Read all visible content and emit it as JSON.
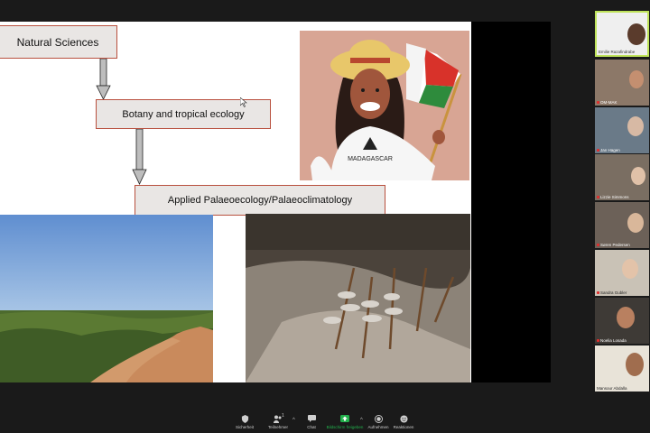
{
  "slide": {
    "flow": [
      "Natural Sciences",
      "Botany and tropical ecology",
      "Applied Palaeoecology/Palaeoclimatology"
    ],
    "illustration_text": "MADAGASCAR"
  },
  "participants": [
    {
      "name": "Emilie Razafindrabe",
      "active": true
    },
    {
      "name": "OM-MAK",
      "active": false
    },
    {
      "name": "Jan Hagen",
      "active": false
    },
    {
      "name": "Lizzie Simmons",
      "active": false
    },
    {
      "name": "Søren Pedersen",
      "active": false
    },
    {
      "name": "Sandra Gubler",
      "active": false
    },
    {
      "name": "Noelia Losada",
      "active": false
    },
    {
      "name": "Mansour Abdalla",
      "active": false
    }
  ],
  "toolbar": {
    "security": "Sicherheit",
    "participants": "Teilnehmer",
    "participants_count": "1",
    "chat": "Chat",
    "share": "Bildschirm freigeben",
    "record": "Aufnehmen",
    "reactions": "Reaktionen"
  },
  "colors": {
    "background": "#1a1a1a",
    "box_fill": "#e9e6e4",
    "box_border": "#b9503e",
    "share_green": "#22b14c",
    "active_speaker": "#bfe35a"
  }
}
